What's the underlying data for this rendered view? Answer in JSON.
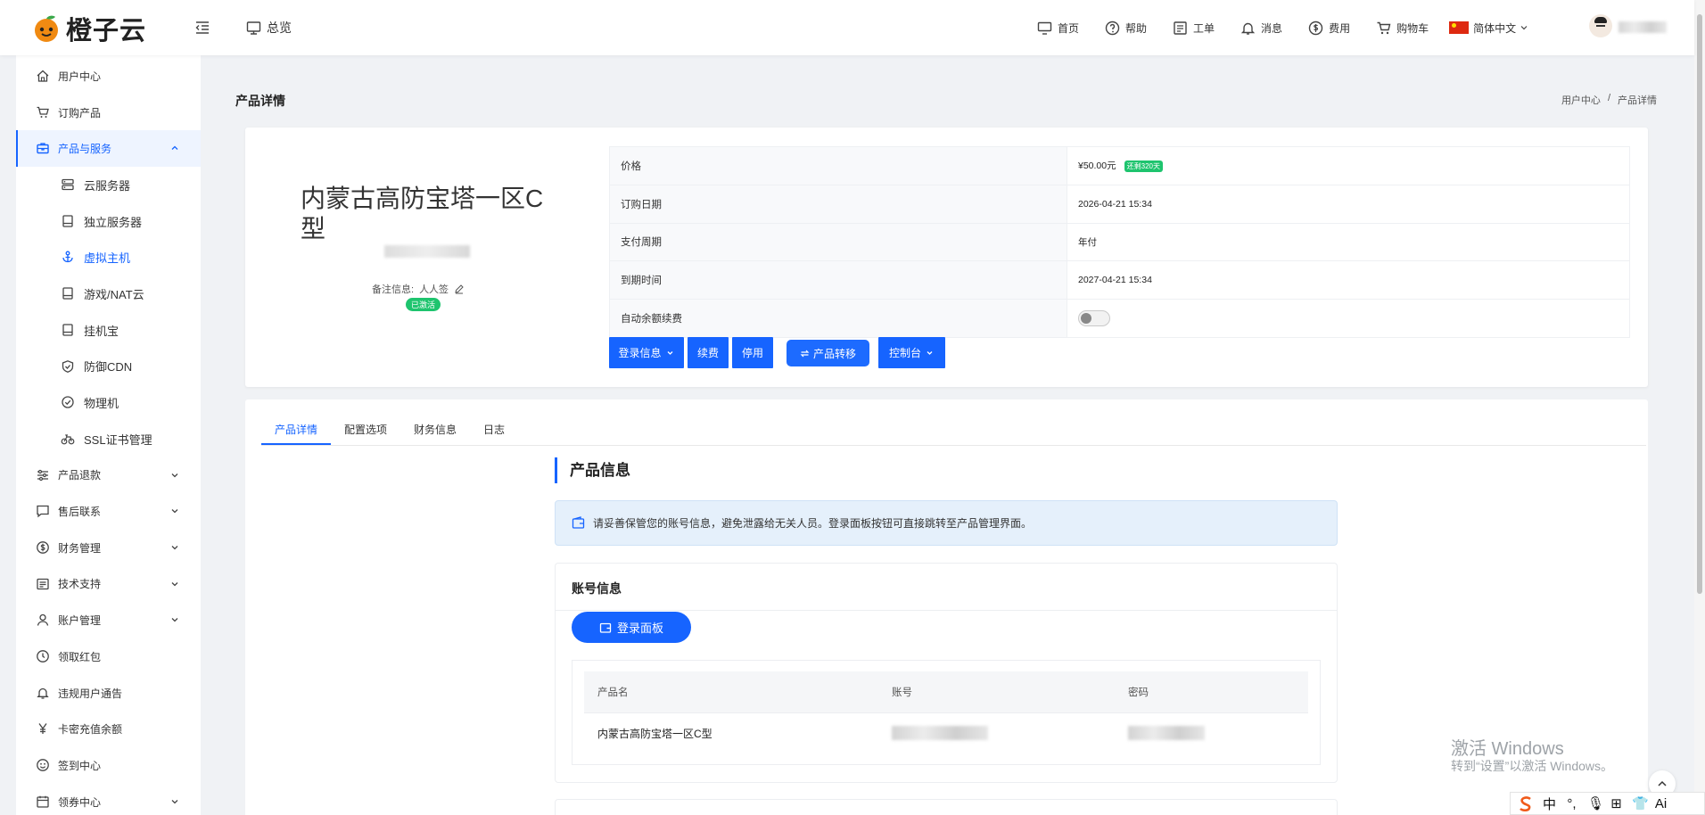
{
  "brand": {
    "name": "橙子云"
  },
  "header": {
    "overview_label": "总览",
    "nav": [
      "首页",
      "帮助",
      "工单",
      "消息",
      "费用",
      "购物车"
    ],
    "language": "简体中文"
  },
  "sidebar": {
    "items": [
      {
        "label": "用户中心",
        "icon": "home-icon"
      },
      {
        "label": "订购产品",
        "icon": "cart-icon"
      },
      {
        "label": "产品与服务",
        "icon": "briefcase-icon",
        "expanded": true
      },
      {
        "label": "云服务器",
        "icon": "server-icon",
        "sub": true
      },
      {
        "label": "独立服务器",
        "icon": "drive-icon",
        "sub": true
      },
      {
        "label": "虚拟主机",
        "icon": "anchor-icon",
        "sub": true,
        "current": true
      },
      {
        "label": "游戏/NAT云",
        "icon": "drive-icon",
        "sub": true
      },
      {
        "label": "挂机宝",
        "icon": "drive-icon",
        "sub": true
      },
      {
        "label": "防御CDN",
        "icon": "shield-icon",
        "sub": true
      },
      {
        "label": "物理机",
        "icon": "check-circle-icon",
        "sub": true
      },
      {
        "label": "SSL证书管理",
        "icon": "bicycle-icon",
        "sub": true
      },
      {
        "label": "产品退款",
        "icon": "sliders-icon",
        "chevron": true
      },
      {
        "label": "售后联系",
        "icon": "message-icon",
        "chevron": true
      },
      {
        "label": "财务管理",
        "icon": "dollar-icon",
        "chevron": true
      },
      {
        "label": "技术支持",
        "icon": "doc-icon",
        "chevron": true
      },
      {
        "label": "账户管理",
        "icon": "user-icon",
        "chevron": true
      },
      {
        "label": "领取红包",
        "icon": "coin-icon"
      },
      {
        "label": "违规用户通告",
        "icon": "bell-icon"
      },
      {
        "label": "卡密充值余额",
        "icon": "yen-icon"
      },
      {
        "label": "签到中心",
        "icon": "smile-icon"
      },
      {
        "label": "领券中心",
        "icon": "calendar-icon",
        "chevron": true
      }
    ]
  },
  "page": {
    "title": "产品详情",
    "breadcrumb": [
      "用户中心",
      "/",
      "产品详情"
    ]
  },
  "product": {
    "name": "内蒙古高防宝塔一区C型",
    "remark_label": "备注信息:",
    "remark_value": "人人签",
    "status": "已激活",
    "info": [
      {
        "key": "价格",
        "value": "¥50.00元",
        "tag": "还剩320天"
      },
      {
        "key": "订购日期",
        "value": "2026-04-21 15:34"
      },
      {
        "key": "支付周期",
        "value": "年付"
      },
      {
        "key": "到期时间",
        "value": "2027-04-21 15:34"
      },
      {
        "key": "自动余额续费",
        "toggle": false
      }
    ],
    "actions": {
      "login_info": "登录信息",
      "renew": "续费",
      "stop": "停用",
      "transfer": "产品转移",
      "console": "控制台"
    }
  },
  "tabs": [
    "产品详情",
    "配置选项",
    "财务信息",
    "日志"
  ],
  "section": {
    "title": "产品信息",
    "notice": "请妥善保管您的账号信息，避免泄露给无关人员。登录面板按钮可直接跳转至产品管理界面。"
  },
  "account": {
    "title": "账号信息",
    "login_button": "登录面板",
    "columns": [
      "产品名",
      "账号",
      "密码"
    ],
    "row": {
      "product": "内蒙古高防宝塔一区C型"
    }
  },
  "watermark": {
    "line1": "激活 Windows",
    "line2": "转到“设置”以激活 Windows。"
  },
  "ime": [
    "中",
    "°,",
    "🎙",
    "⊞",
    "👕",
    "Ai"
  ],
  "colors": {
    "accent": "#1664ff",
    "success": "#1ec46e",
    "notice_bg": "#e5f0fb"
  }
}
